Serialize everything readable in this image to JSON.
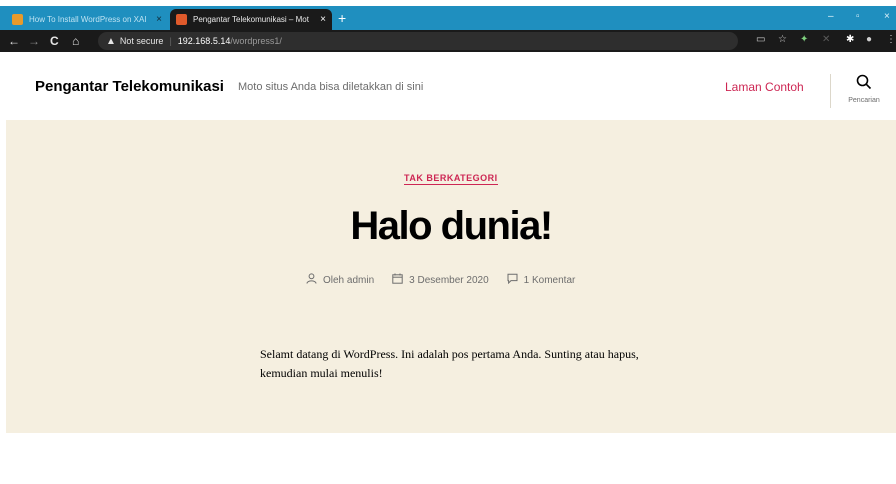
{
  "browser": {
    "tabs": [
      {
        "title": "How To Install WordPress on XAI",
        "close": "×"
      },
      {
        "title": "Pengantar Telekomunikasi – Mot",
        "close": "×"
      }
    ],
    "new_tab": "+",
    "window_controls": {
      "minimize": "–",
      "maximize": "▫",
      "close": "×"
    },
    "nav": {
      "back": "←",
      "forward": "→",
      "reload": "C",
      "home": "⌂"
    },
    "address": {
      "security_icon": "warning-icon",
      "security_label": "Not secure",
      "separator": "|",
      "host": "192.168.5.14",
      "path": "/wordpress1/"
    }
  },
  "site": {
    "title": "Pengantar Telekomunikasi",
    "description": "Moto situs Anda bisa diletakkan di sini",
    "menu": [
      {
        "label": "Laman Contoh"
      }
    ],
    "search_label": "Pencarian"
  },
  "post": {
    "category": "TAK BERKATEGORI",
    "title": "Halo dunia!",
    "author": "Oleh admin",
    "date": "3 Desember 2020",
    "comments": "1 Komentar",
    "content": "Selamt datang di WordPress. Ini adalah pos pertama Anda. Sunting atau hapus, kemudian mulai menulis!"
  },
  "colors": {
    "tabbar": "#1f8fbf",
    "toolbar": "#1a1a1a",
    "accent": "#cd2653",
    "hero_bg": "#f5efe0"
  }
}
